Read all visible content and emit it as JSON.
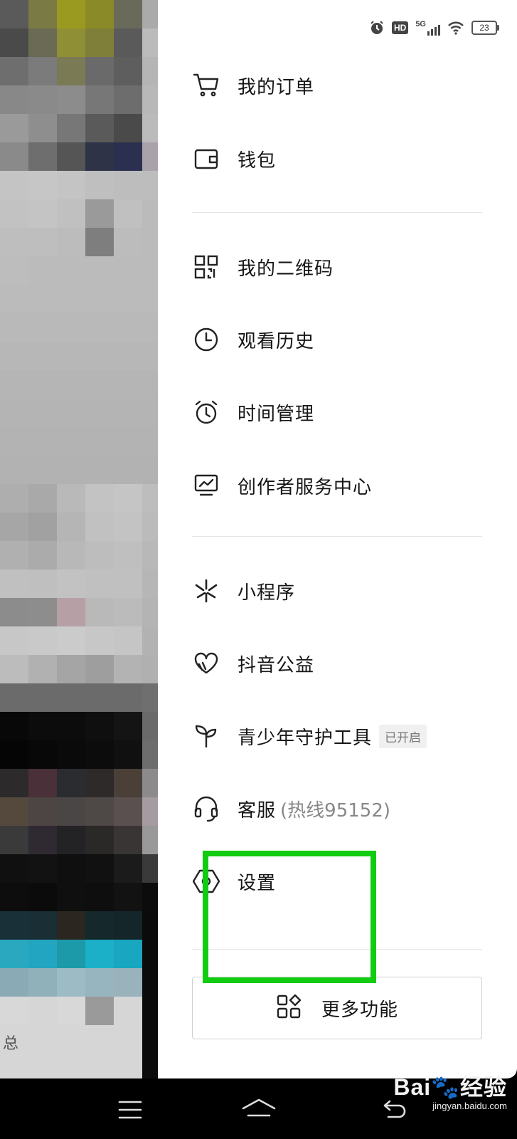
{
  "status_bar": {
    "icons": [
      "alarm-icon",
      "hd-icon",
      "signal-5g-icon",
      "wifi-icon"
    ],
    "network": "5G",
    "hd": "HD",
    "battery": "23"
  },
  "background": {
    "partial_text": "总"
  },
  "drawer": {
    "items": [
      {
        "label": "我的订单",
        "icon": "cart-icon"
      },
      {
        "label": "钱包",
        "icon": "wallet-icon"
      },
      {
        "label": "我的二维码",
        "icon": "qr-code-icon"
      },
      {
        "label": "观看历史",
        "icon": "clock-icon"
      },
      {
        "label": "时间管理",
        "icon": "alarm-clock-icon"
      },
      {
        "label": "创作者服务中心",
        "icon": "monitor-chart-icon"
      },
      {
        "label": "小程序",
        "icon": "mini-program-icon"
      },
      {
        "label": "抖音公益",
        "icon": "heart-icon"
      },
      {
        "label": "青少年守护工具",
        "icon": "sprout-icon",
        "badge": "已开启"
      },
      {
        "label": "客服",
        "icon": "headset-icon",
        "sub": "(热线95152)"
      },
      {
        "label": "设置",
        "icon": "settings-hexagon-icon"
      }
    ],
    "more_button": {
      "label": "更多功能",
      "icon": "grid-apps-icon"
    }
  },
  "annotation": {
    "color": "#11cc11"
  },
  "nav_bar": {
    "icons": [
      "menu-icon",
      "home-icon",
      "back-icon"
    ]
  },
  "watermark": {
    "brand": "Bai",
    "brand_suffix": "经验",
    "url": "jingyan.baidu.com"
  }
}
